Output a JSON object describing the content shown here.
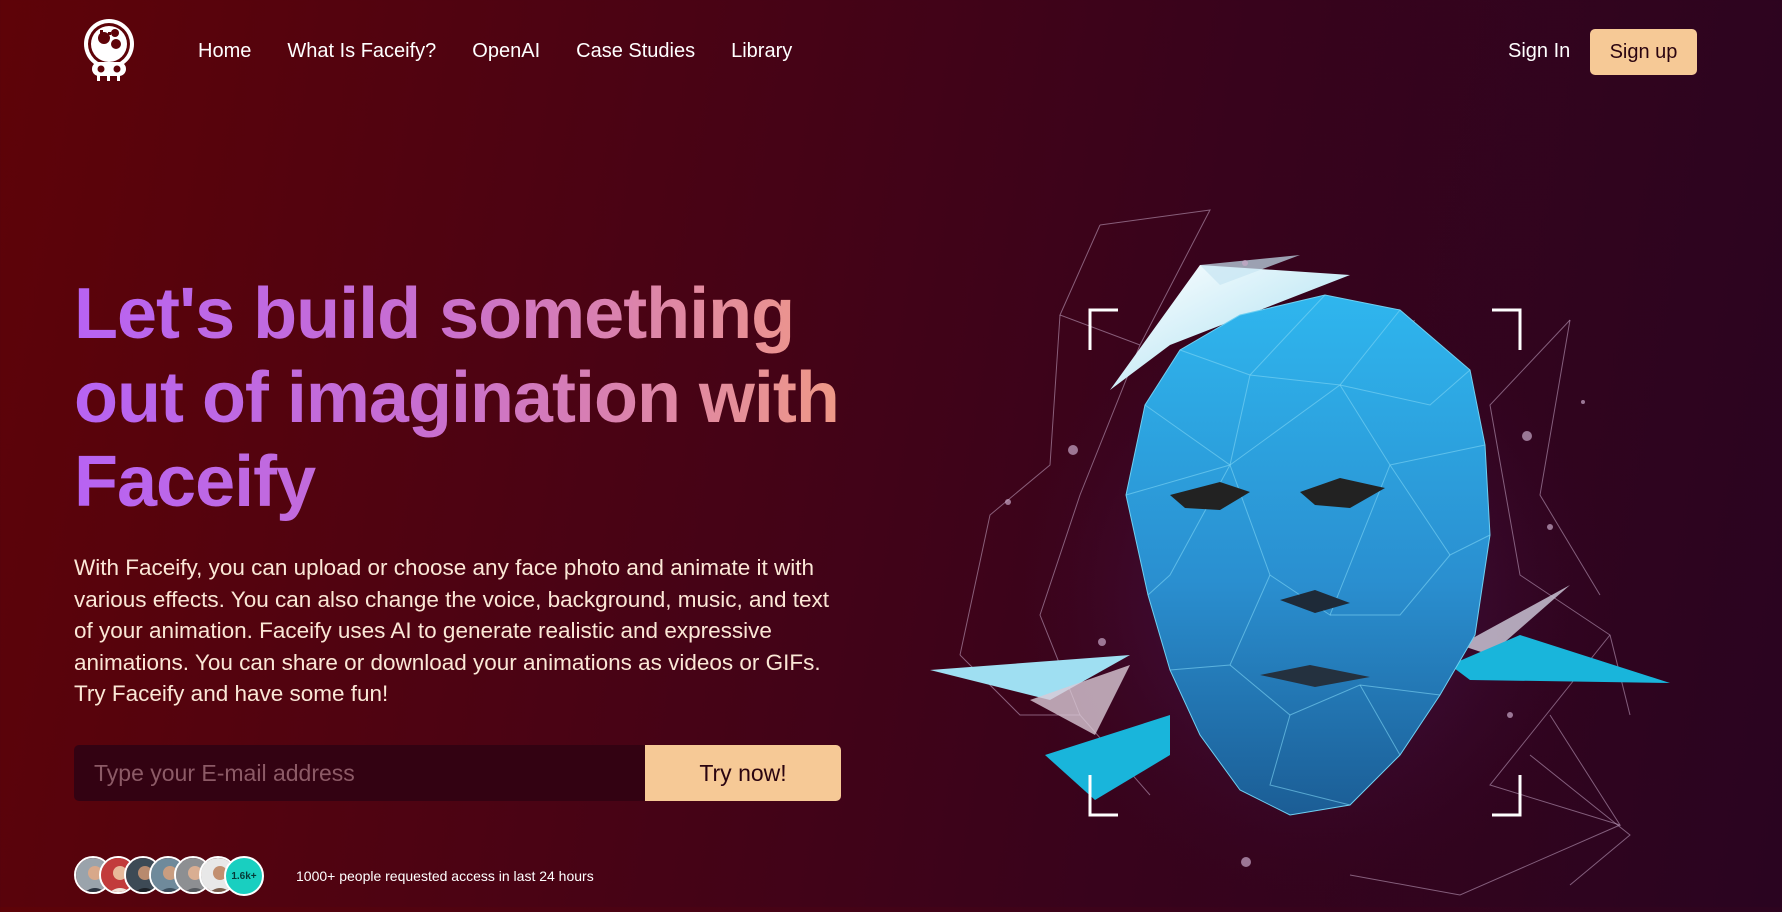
{
  "header": {
    "logo_icon": "robot-face-logo-icon",
    "nav": [
      "Home",
      "What Is Faceify?",
      "OpenAI",
      "Case Studies",
      "Library"
    ],
    "sign_in": "Sign In",
    "sign_up": "Sign up"
  },
  "hero": {
    "headline_line1": "Let's build something",
    "headline_line2": "out of imagination with",
    "headline_line3": "Faceify",
    "description": "With Faceify, you can upload or choose any face photo and animate it with various effects. You can also change the voice, background, music, and text of your animation. Faceify uses AI to generate realistic and expressive animations. You can share or download your animations as videos or GIFs. Try Faceify and have some fun!",
    "email_placeholder": "Type your E-mail address",
    "cta": "Try now!",
    "avatar_count": "1.6k+",
    "social_proof": "1000+ people requested access in last 24 hours"
  },
  "illustration": {
    "icon": "low-poly-ai-face-icon"
  },
  "colors": {
    "background_start": "#5e0308",
    "background_end": "#2a0420",
    "accent": "#f6c996",
    "headline_gradient_start": "#b763f3",
    "headline_gradient_end": "#f09a84",
    "face": "#2a9ee0",
    "avatar_badge": "#19cfc0"
  }
}
